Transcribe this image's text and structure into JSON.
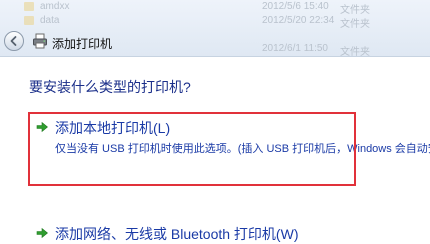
{
  "background_list": {
    "rows": [
      {
        "name": "amdxx",
        "date": "2012/5/6 15:40",
        "type": "文件夹"
      },
      {
        "name": "data",
        "date": "2012/5/20 22:34",
        "type": "文件夹"
      },
      {
        "name": "",
        "date": "",
        "type": ""
      },
      {
        "name": "",
        "date": "2012/6/1 11:50",
        "type": "文件夹"
      }
    ]
  },
  "titlebar": {
    "title": "添加打印机",
    "back_icon": "back-arrow-icon",
    "app_icon": "printer-icon"
  },
  "main": {
    "question": "要安装什么类型的打印机?",
    "options": [
      {
        "title": "添加本地打印机(L)",
        "description": "仅当没有 USB 打印机时使用此选项。(插入 USB 打印机后，Windows 会自动安装",
        "icon": "green-arrow-icon",
        "highlighted": true
      },
      {
        "title": "添加网络、无线或 Bluetooth 打印机(W)",
        "description": "",
        "icon": "green-arrow-icon",
        "highlighted": false
      }
    ]
  },
  "colors": {
    "link_blue": "#1a3aa6",
    "heading_blue": "#1b2f8a",
    "highlight_red": "#e1313a",
    "arrow_green": "#2f9d2f"
  }
}
